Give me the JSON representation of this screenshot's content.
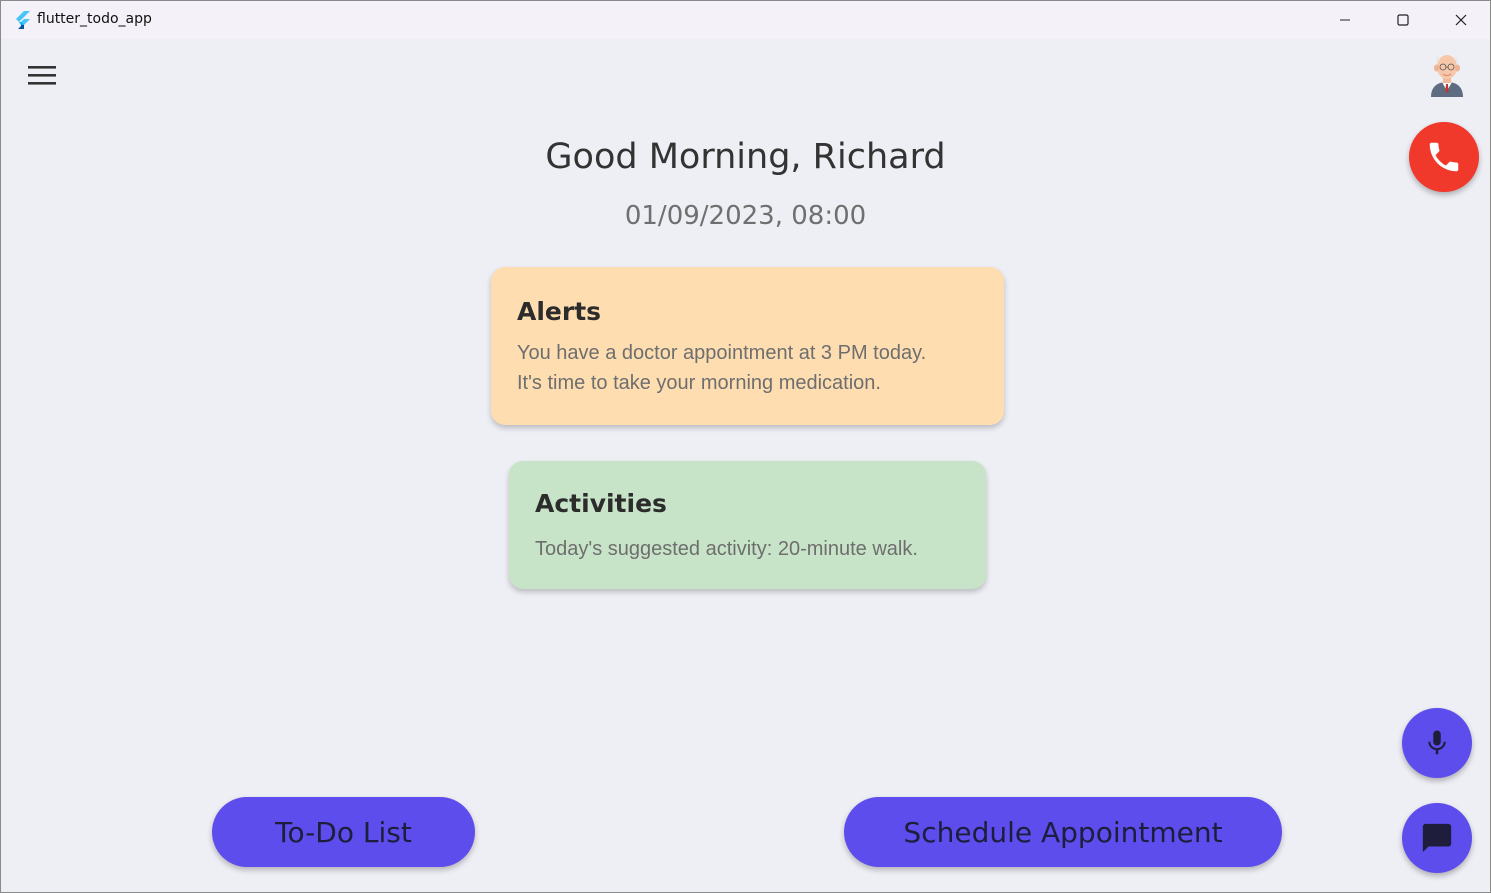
{
  "window": {
    "title": "flutter_todo_app"
  },
  "header": {
    "menu_icon": "menu-icon",
    "avatar_icon": "elderly-man-avatar",
    "call_icon": "phone-icon",
    "call_color": "#f0382b"
  },
  "main": {
    "greeting": "Good Morning, Richard",
    "datetime": "01/09/2023, 08:00",
    "alerts": {
      "title": "Alerts",
      "lines": [
        "You have a doctor appointment at 3 PM today.",
        "It's time to take your morning medication."
      ],
      "color": "#fedeb1"
    },
    "activities": {
      "title": "Activities",
      "lines": [
        "Today's suggested activity: 20-minute walk."
      ],
      "color": "#c8e4c8"
    }
  },
  "actions": {
    "todo_label": "To-Do List",
    "schedule_label": "Schedule Appointment",
    "mic_icon": "mic-icon",
    "chat_icon": "chat-icon",
    "accent_color": "#5d4ded"
  }
}
